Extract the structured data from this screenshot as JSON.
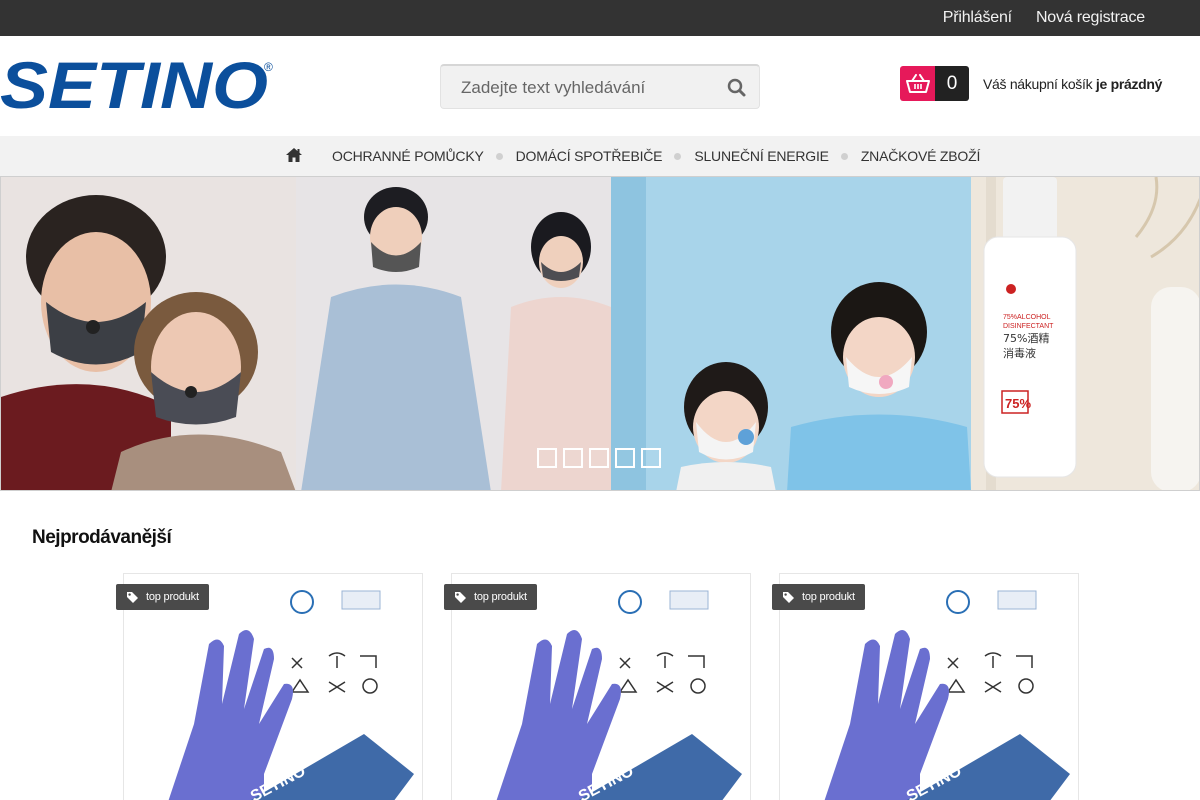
{
  "topbar": {
    "login": "Přihlášení",
    "register": "Nová registrace"
  },
  "logo": {
    "text": "SETINO",
    "mark": "®"
  },
  "search": {
    "placeholder": "Zadejte text vyhledávání",
    "icon": "search-icon"
  },
  "cart": {
    "count": "0",
    "label": "Váš nákupní košík",
    "status": "je prázdný",
    "icon": "basket-icon"
  },
  "nav": {
    "home_icon": "home-icon",
    "items": [
      {
        "label": "OCHRANNÉ POMŮCKY"
      },
      {
        "label": "DOMÁCÍ SPOTŘEBIČE"
      },
      {
        "label": "SLUNEČNÍ ENERGIE"
      },
      {
        "label": "ZNAČKOVÉ ZBOŽÍ"
      }
    ]
  },
  "banner": {
    "slides_count": 5,
    "bottle_text": {
      "line1": "75%ALCOHOL",
      "line2": "DISINFECTANT",
      "line3": "75%酒精",
      "line4": "消毒液",
      "badge": "75%"
    }
  },
  "section": {
    "title": "Nejprodávanější"
  },
  "products": [
    {
      "badge": "top produkt",
      "brand": "SETINO"
    },
    {
      "badge": "top produkt",
      "brand": "SETINO"
    },
    {
      "badge": "top produkt",
      "brand": "SETINO"
    }
  ],
  "colors": {
    "topbar": "#333333",
    "logo_blue": "#0b4f9c",
    "cart_pink": "#e6195a",
    "nav_bg": "#f2f2f2",
    "glove": "#6a6fd0"
  }
}
